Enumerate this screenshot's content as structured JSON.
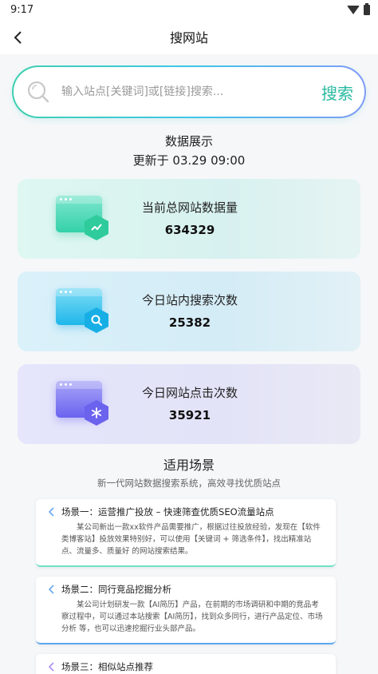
{
  "status": {
    "time": "9:17"
  },
  "header": {
    "title": "搜网站"
  },
  "search": {
    "placeholder": "输入站点[关键词]或[链接]搜索...",
    "button_label": "搜索"
  },
  "stats": {
    "title": "数据展示",
    "updated": "更新于 03.29 09:00",
    "cards": [
      {
        "label": "当前总网站数据量",
        "value": "634329",
        "icon": "trend-icon",
        "color": "#2fcb9c"
      },
      {
        "label": "今日站内搜索次数",
        "value": "25382",
        "icon": "search-icon",
        "color": "#17aee6"
      },
      {
        "label": "今日网站点击次数",
        "value": "35921",
        "icon": "snowflake-icon",
        "color": "#6b62ee"
      }
    ]
  },
  "scenes": {
    "title": "适用场景",
    "subtitle": "新一代网站数据搜索系统，高效寻找优质站点",
    "items": [
      {
        "title": "场景一：运营推广投放 – 快速筛查优质SEO流量站点",
        "body": "某公司新出一款xx软件产品需要推广，根据过往投放经验，发现在【软件类博客站】投放效果特别好，可以使用【关键词 + 筛选条件】，找出精准站点、流量多、质量好 的网站搜索结果。"
      },
      {
        "title": "场景二：同行竞品挖掘分析",
        "body": "某公司计划研发一款【AI简历】产品，在前期的市场调研和中期的竞品考察过程中，可以通过本站搜索【AI简历】，找到众多同行，进行产品定位、市场分析 等，也可以迅速挖掘行业头部产品。"
      },
      {
        "title": "场景三：相似站点推荐",
        "body": ""
      }
    ]
  }
}
